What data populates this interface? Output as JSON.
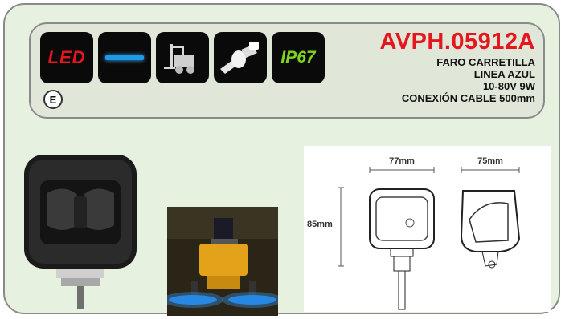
{
  "product": {
    "code": "AVPH.05912A",
    "description": [
      "FARO CARRETILLA",
      "LINEA AZUL",
      "10-80V 9W",
      "CONEXIÓN CABLE 500mm"
    ]
  },
  "badges": {
    "led": "LED",
    "ip": "IP67",
    "e_mark": "E"
  },
  "drawing": {
    "width_label": "77mm",
    "depth_label": "75mm",
    "height_label": "85mm"
  },
  "colors": {
    "accent_red": "#e3171d",
    "beam_blue": "#1e7fe0",
    "panel_bg": "#e7f1df"
  }
}
